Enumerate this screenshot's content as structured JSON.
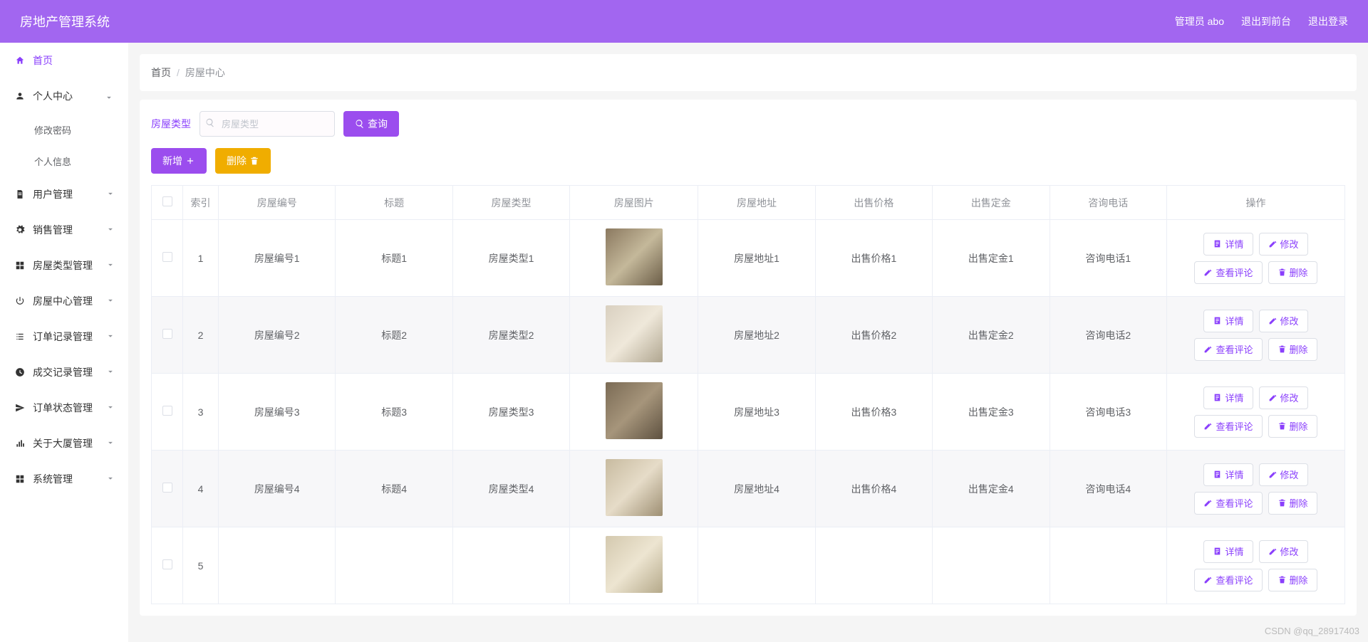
{
  "header": {
    "title": "房地产管理系统",
    "admin": "管理员 abo",
    "to_front": "退出到前台",
    "logout": "退出登录"
  },
  "sidebar": {
    "home": "首页",
    "items": [
      {
        "label": "个人中心",
        "expanded": true
      },
      {
        "label": "用户管理",
        "expanded": false
      },
      {
        "label": "销售管理",
        "expanded": false
      },
      {
        "label": "房屋类型管理",
        "expanded": false
      },
      {
        "label": "房屋中心管理",
        "expanded": false
      },
      {
        "label": "订单记录管理",
        "expanded": false
      },
      {
        "label": "成交记录管理",
        "expanded": false
      },
      {
        "label": "订单状态管理",
        "expanded": false
      },
      {
        "label": "关于大厦管理",
        "expanded": false
      },
      {
        "label": "系统管理",
        "expanded": false
      }
    ],
    "sub": {
      "change_pwd": "修改密码",
      "profile": "个人信息"
    }
  },
  "breadcrumb": {
    "home": "首页",
    "current": "房屋中心"
  },
  "filter": {
    "label": "房屋类型",
    "placeholder": "房屋类型",
    "search": "查询"
  },
  "actions": {
    "add": "新增",
    "delete": "删除"
  },
  "table": {
    "headers": {
      "idx": "索引",
      "code": "房屋编号",
      "title": "标题",
      "type": "房屋类型",
      "img": "房屋图片",
      "addr": "房屋地址",
      "price": "出售价格",
      "deposit": "出售定金",
      "phone": "咨询电话",
      "op": "操作"
    },
    "ops": {
      "detail": "详情",
      "edit": "修改",
      "review": "查看评论",
      "delete": "删除"
    },
    "rows": [
      {
        "idx": "1",
        "code": "房屋编号1",
        "title": "标题1",
        "type": "房屋类型1",
        "addr": "房屋地址1",
        "price": "出售价格1",
        "deposit": "出售定金1",
        "phone": "咨询电话1"
      },
      {
        "idx": "2",
        "code": "房屋编号2",
        "title": "标题2",
        "type": "房屋类型2",
        "addr": "房屋地址2",
        "price": "出售价格2",
        "deposit": "出售定金2",
        "phone": "咨询电话2"
      },
      {
        "idx": "3",
        "code": "房屋编号3",
        "title": "标题3",
        "type": "房屋类型3",
        "addr": "房屋地址3",
        "price": "出售价格3",
        "deposit": "出售定金3",
        "phone": "咨询电话3"
      },
      {
        "idx": "4",
        "code": "房屋编号4",
        "title": "标题4",
        "type": "房屋类型4",
        "addr": "房屋地址4",
        "price": "出售价格4",
        "deposit": "出售定金4",
        "phone": "咨询电话4"
      },
      {
        "idx": "5",
        "code": "",
        "title": "",
        "type": "",
        "addr": "",
        "price": "",
        "deposit": "",
        "phone": ""
      }
    ]
  },
  "watermark": "CSDN @qq_28917403"
}
